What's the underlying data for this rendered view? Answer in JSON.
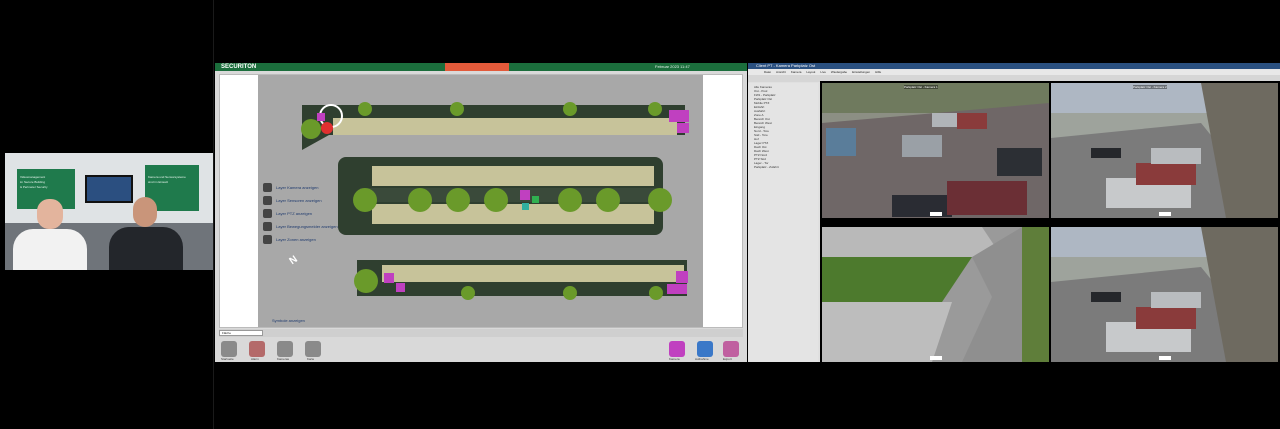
{
  "webcam": {
    "banner_left_lines": [
      "Videomanagement",
      "im Secure Building",
      "& Perimeter Security"
    ],
    "banner_right_lines": [
      "Kamera und Sensorsysteme",
      "sind im Einsatz"
    ]
  },
  "app": {
    "brand": "SECURITON",
    "date": "Februar 2023 11:47",
    "layers": [
      {
        "label": "Layer Kamera anzeigen"
      },
      {
        "label": "Layer Sensoren anzeigen"
      },
      {
        "label": "Layer PTZ anzeigen"
      },
      {
        "label": "Layer Bewegungsmelder anzeigen"
      },
      {
        "label": "Layer Zonen anzeigen"
      }
    ],
    "map_legend": "Symbole anzeigen",
    "north": "N",
    "zoom_value": "Fläche",
    "toolbar_buttons": [
      {
        "label": "Startseite",
        "icon": "home-icon"
      },
      {
        "label": "Alarm",
        "icon": "alarm-icon"
      },
      {
        "label": "Kameras",
        "icon": "camera-icon"
      },
      {
        "label": "Karte",
        "icon": "map-icon"
      }
    ],
    "right_tools": [
      {
        "label": "Kamera",
        "icon": "camera-tool-icon"
      },
      {
        "label": "Aufnahme",
        "icon": "record-icon"
      },
      {
        "label": "Export",
        "icon": "export-icon"
      }
    ]
  },
  "cam": {
    "title": "Client PT - Kamera Parkplatz Ost",
    "menu": [
      "Datei",
      "Ansicht",
      "Kamera",
      "Layout",
      "Live",
      "Wiedergabe",
      "Einstellungen",
      "Hilfe"
    ],
    "tree": [
      "Alle Kameras",
      "Ost - Pool",
      "FW1 - Parkplatz",
      "Parkplatz Ost",
      "Mobile PTZ",
      "Einfahrt",
      "Ausfahrt",
      "Zone A",
      "Bereich Ost",
      "Bereich West",
      "Eingang",
      "Nord - Tore",
      "Süd - Tore",
      "Hof",
      "Lager PTZ",
      "Dach Ost",
      "Dach West",
      "PTZ Nord",
      "PTZ Süd",
      "Lager - Tor",
      "Parkplatz - Zufahrt"
    ],
    "tiles": [
      {
        "label": "Parkplatz Ost - Kamera 1"
      },
      {
        "label": "Parkplatz Ost - Kamera 2"
      },
      {
        "label": "Parkplatz Ost - Kamera 3"
      },
      {
        "label": "Parkplatz Ost - Kamera 4"
      }
    ]
  }
}
